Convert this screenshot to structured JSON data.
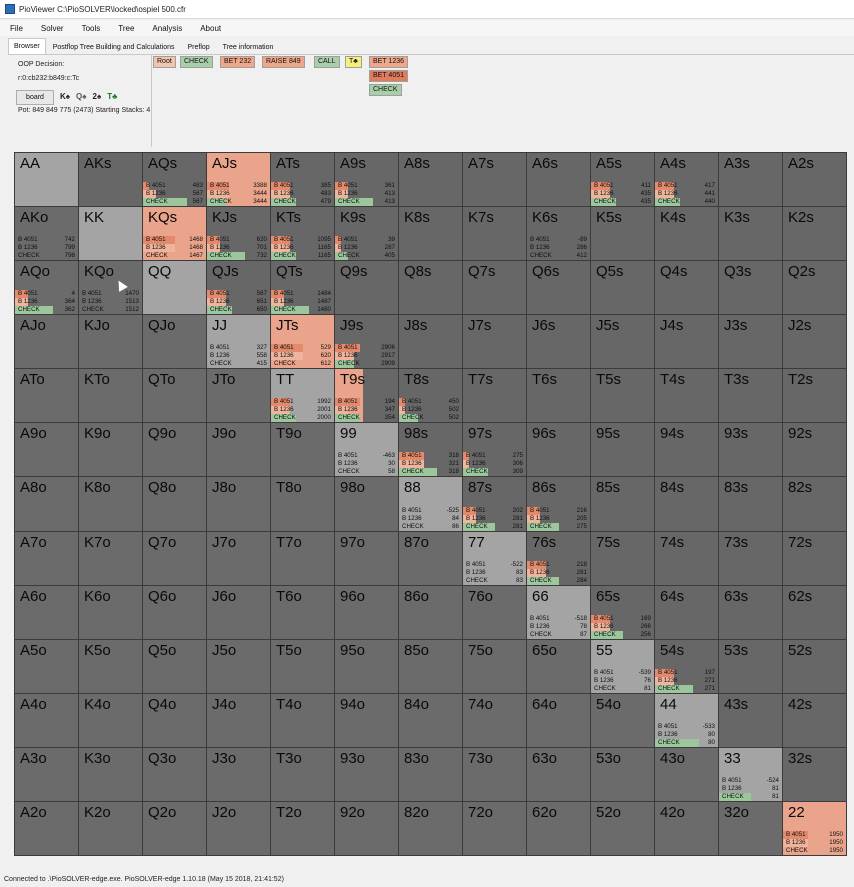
{
  "window": {
    "title": "PioViewer C:\\PioSOLVER\\locked\\ospiel 500.cfr"
  },
  "menu": [
    "File",
    "Solver",
    "Tools",
    "Tree",
    "Analysis",
    "About"
  ],
  "tabs": [
    "Browser",
    "Postflop Tree Building and Calculations",
    "Preflop",
    "Tree information"
  ],
  "active_tab": 0,
  "left_panel": {
    "decision_label": "OOP Decision:",
    "board_line": "r:0:cb232:b849:c:Tc",
    "board_button": "board",
    "cards": [
      "K♠",
      "Q♠",
      "2♠",
      "T♣"
    ],
    "pot_line": "Pot: 849 849 775 (2473) Starting Stacks: 4"
  },
  "tree_nodes": [
    {
      "label": "Root",
      "row": 0,
      "col": 0,
      "color": "#f2c4ad"
    },
    {
      "label": "CHECK",
      "row": 0,
      "col": 1,
      "color": "#a9cfa8"
    },
    {
      "label": "BET 232",
      "row": 0,
      "col": 2,
      "color": "#f0a688"
    },
    {
      "label": "RAISE 849",
      "row": 0,
      "col": 3,
      "color": "#f0a688"
    },
    {
      "label": "CALL",
      "row": 0,
      "col": 4,
      "color": "#a9cfa8"
    },
    {
      "label": "T♣",
      "row": 0,
      "col": 5,
      "color": "#f5f07a"
    },
    {
      "label": "BET 1236",
      "row": 0,
      "col": 6,
      "color": "#f0a688"
    },
    {
      "label": "BET 4051",
      "row": 1,
      "col": 6,
      "color": "#e07b5c"
    },
    {
      "label": "CHECK",
      "row": 2,
      "col": 6,
      "color": "#a9cfa8"
    }
  ],
  "colors": {
    "bet_large": "#e38a6c",
    "bet_small": "#f0b49d",
    "check": "#9cc79c",
    "pair_cell": "#a4a4a4",
    "suited_cell": "#676767",
    "offsuit_cell": "#6b6b6b"
  },
  "strategy_labels": [
    "B 4051",
    "B 1236",
    "CHECK"
  ],
  "hands": [
    [
      "AA",
      "AKs",
      "AQs",
      "AJs",
      "ATs",
      "A9s",
      "A8s",
      "A7s",
      "A6s",
      "A5s",
      "A4s",
      "A3s",
      "A2s"
    ],
    [
      "AKo",
      "KK",
      "KQs",
      "KJs",
      "KTs",
      "K9s",
      "K8s",
      "K7s",
      "K6s",
      "K5s",
      "K4s",
      "K3s",
      "K2s"
    ],
    [
      "AQo",
      "KQo",
      "QQ",
      "QJs",
      "QTs",
      "Q9s",
      "Q8s",
      "Q7s",
      "Q6s",
      "Q5s",
      "Q4s",
      "Q3s",
      "Q2s"
    ],
    [
      "AJo",
      "KJo",
      "QJo",
      "JJ",
      "JTs",
      "J9s",
      "J8s",
      "J7s",
      "J6s",
      "J5s",
      "J4s",
      "J3s",
      "J2s"
    ],
    [
      "ATo",
      "KTo",
      "QTo",
      "JTo",
      "TT",
      "T9s",
      "T8s",
      "T7s",
      "T6s",
      "T5s",
      "T4s",
      "T3s",
      "T2s"
    ],
    [
      "A9o",
      "K9o",
      "Q9o",
      "J9o",
      "T9o",
      "99",
      "98s",
      "97s",
      "96s",
      "95s",
      "94s",
      "93s",
      "92s"
    ],
    [
      "A8o",
      "K8o",
      "Q8o",
      "J8o",
      "T8o",
      "98o",
      "88",
      "87s",
      "86s",
      "85s",
      "84s",
      "83s",
      "82s"
    ],
    [
      "A7o",
      "K7o",
      "Q7o",
      "J7o",
      "T7o",
      "97o",
      "87o",
      "77",
      "76s",
      "75s",
      "74s",
      "73s",
      "72s"
    ],
    [
      "A6o",
      "K6o",
      "Q6o",
      "J6o",
      "T6o",
      "96o",
      "86o",
      "76o",
      "66",
      "65s",
      "64s",
      "63s",
      "62s"
    ],
    [
      "A5o",
      "K5o",
      "Q5o",
      "J5o",
      "T5o",
      "95o",
      "85o",
      "75o",
      "65o",
      "55",
      "54s",
      "53s",
      "52s"
    ],
    [
      "A4o",
      "K4o",
      "Q4o",
      "J4o",
      "T4o",
      "94o",
      "84o",
      "74o",
      "64o",
      "54o",
      "44",
      "43s",
      "42s"
    ],
    [
      "A3o",
      "K3o",
      "Q3o",
      "J3o",
      "T3o",
      "93o",
      "83o",
      "73o",
      "63o",
      "53o",
      "43o",
      "33",
      "32s"
    ],
    [
      "A2o",
      "K2o",
      "Q2o",
      "J2o",
      "T2o",
      "92o",
      "82o",
      "72o",
      "62o",
      "52o",
      "42o",
      "32o",
      "22"
    ]
  ],
  "strategy": {
    "AQs": {
      "values": [
        "483",
        "567",
        "567"
      ],
      "mix": [
        0.1,
        0.2,
        0.7
      ]
    },
    "AJs": {
      "values": [
        "3388",
        "3444",
        "3444"
      ],
      "mix": [
        0.35,
        0.35,
        0.3
      ],
      "fill": 1.0,
      "fill_color": "#e9a48b"
    },
    "ATs": {
      "values": [
        "385",
        "483",
        "479"
      ],
      "mix": [
        0.3,
        0.3,
        0.4
      ]
    },
    "A9s": {
      "values": [
        "361",
        "413",
        "413"
      ],
      "mix": [
        0.2,
        0.2,
        0.6
      ]
    },
    "A5s": {
      "values": [
        "411",
        "435",
        "435"
      ],
      "mix": [
        0.3,
        0.3,
        0.4
      ]
    },
    "A4s": {
      "values": [
        "417",
        "441",
        "440"
      ],
      "mix": [
        0.3,
        0.3,
        0.4
      ]
    },
    "AKo": {
      "values": [
        "742",
        "799",
        "798"
      ],
      "mix": [
        0.0,
        0.0,
        0.0
      ]
    },
    "KQs": {
      "values": [
        "1468",
        "1468",
        "1467"
      ],
      "mix": [
        0.5,
        0.5,
        0.0
      ],
      "fill": 1.0,
      "fill_color": "#e9a48b"
    },
    "KJs": {
      "values": [
        "620",
        "701",
        "732"
      ],
      "mix": [
        0.2,
        0.2,
        0.6
      ]
    },
    "KTs": {
      "values": [
        "1095",
        "1165",
        "1165"
      ],
      "mix": [
        0.3,
        0.3,
        0.4
      ]
    },
    "K9s": {
      "values": [
        "39",
        "287",
        "405"
      ],
      "mix": [
        0.1,
        0.1,
        0.2
      ]
    },
    "K6s": {
      "values": [
        "-89",
        "286",
        "412"
      ],
      "mix": [
        0.0,
        0.0,
        0.0
      ]
    },
    "AQo": {
      "values": [
        "4",
        "364",
        "362"
      ],
      "mix": [
        0.2,
        0.2,
        0.6
      ]
    },
    "KQo": {
      "values": [
        "1470",
        "1513",
        "1512"
      ],
      "mix": [
        0.0,
        0.0,
        0.0
      ]
    },
    "QJs": {
      "values": [
        "567",
        "651",
        "650"
      ],
      "mix": [
        0.3,
        0.3,
        0.4
      ]
    },
    "QTs": {
      "values": [
        "1484",
        "1487",
        "1480"
      ],
      "mix": [
        0.2,
        0.2,
        0.6
      ],
      "check_color": "#9cc79c"
    },
    "JJ": {
      "values": [
        "327",
        "558",
        "415"
      ],
      "mix": [
        0.0,
        0.0,
        0.0
      ]
    },
    "JTs": {
      "values": [
        "529",
        "620",
        "612"
      ],
      "mix": [
        0.5,
        0.5,
        0.0
      ],
      "fill": 1.0,
      "fill_color": "#e9a48b"
    },
    "J9s": {
      "values": [
        "2906",
        "2917",
        "2909"
      ],
      "mix": [
        0.4,
        0.3,
        0.3
      ]
    },
    "TT": {
      "values": [
        "1992",
        "2001",
        "2000"
      ],
      "mix": [
        0.3,
        0.3,
        0.4
      ]
    },
    "T9s": {
      "values": [
        "194",
        "347",
        "354"
      ],
      "mix": [
        0.4,
        0.2,
        0.4
      ],
      "fill": 0.45,
      "fill_color": "#e9a48b"
    },
    "T8s": {
      "values": [
        "450",
        "502",
        "502"
      ],
      "mix": [
        0.1,
        0.1,
        0.3
      ]
    },
    "99": {
      "values": [
        "-463",
        "30",
        "58"
      ],
      "mix": [
        0.0,
        0.0,
        0.0
      ]
    },
    "98s": {
      "values": [
        "318",
        "321",
        "318"
      ],
      "mix": [
        0.4,
        0.4,
        0.6
      ]
    },
    "97s": {
      "values": [
        "275",
        "306",
        "309"
      ],
      "mix": [
        0.1,
        0.1,
        0.4
      ]
    },
    "88": {
      "values": [
        "-525",
        "84",
        "86"
      ],
      "mix": [
        0.0,
        0.0,
        0.0
      ]
    },
    "87s": {
      "values": [
        "202",
        "281",
        "281"
      ],
      "mix": [
        0.2,
        0.2,
        0.5
      ]
    },
    "86s": {
      "values": [
        "216",
        "205",
        "275"
      ],
      "mix": [
        0.2,
        0.2,
        0.5
      ]
    },
    "77": {
      "values": [
        "-522",
        "83",
        "83"
      ],
      "mix": [
        0.0,
        0.0,
        0.0
      ]
    },
    "76s": {
      "values": [
        "218",
        "281",
        "284"
      ],
      "mix": [
        0.3,
        0.3,
        0.5
      ]
    },
    "66": {
      "values": [
        "-518",
        "78",
        "87"
      ],
      "mix": [
        0.0,
        0.0,
        0.0
      ]
    },
    "65s": {
      "values": [
        "169",
        "266",
        "256"
      ],
      "mix": [
        0.3,
        0.3,
        0.5
      ]
    },
    "55": {
      "values": [
        "-539",
        "76",
        "81"
      ],
      "mix": [
        0.0,
        0.0,
        0.0
      ]
    },
    "54s": {
      "values": [
        "197",
        "271",
        "271"
      ],
      "mix": [
        0.3,
        0.3,
        0.6
      ]
    },
    "44": {
      "values": [
        "-533",
        "80",
        "80"
      ],
      "mix": [
        0.0,
        0.0,
        0.7
      ]
    },
    "33": {
      "values": [
        "-524",
        "81",
        "81"
      ],
      "mix": [
        0.0,
        0.0,
        0.5
      ]
    },
    "22": {
      "values": [
        "1950",
        "1950",
        "1950"
      ],
      "mix": [
        0.4,
        0.4,
        0.0
      ],
      "fill": 1.0,
      "fill_color": "#e9a48b"
    }
  },
  "status": "Connected to .\\PioSOLVER-edge.exe. PioSOLVER-edge 1.10.18 (May 15 2018, 21:41:52)"
}
